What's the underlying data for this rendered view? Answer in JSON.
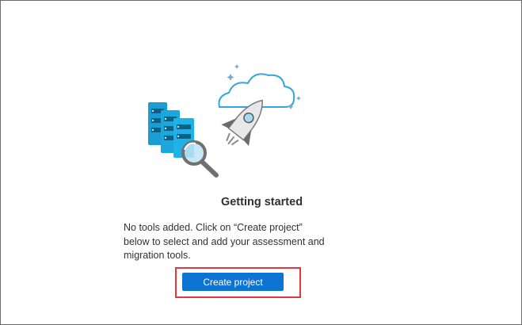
{
  "empty_state": {
    "title": "Getting started",
    "description": "No tools added. Click on “Create project” below to select and add your assessment and migration tools.",
    "create_button_label": "Create project"
  },
  "illustration": {
    "icons": [
      "server-stack-icon",
      "magnifier-icon",
      "rocket-icon",
      "cloud-icon",
      "sparkle-icon"
    ]
  },
  "colors": {
    "server": "#1aa1d6",
    "cloud_stroke": "#34a6db",
    "button": "#0d73d3",
    "highlight": "#e0383e"
  }
}
